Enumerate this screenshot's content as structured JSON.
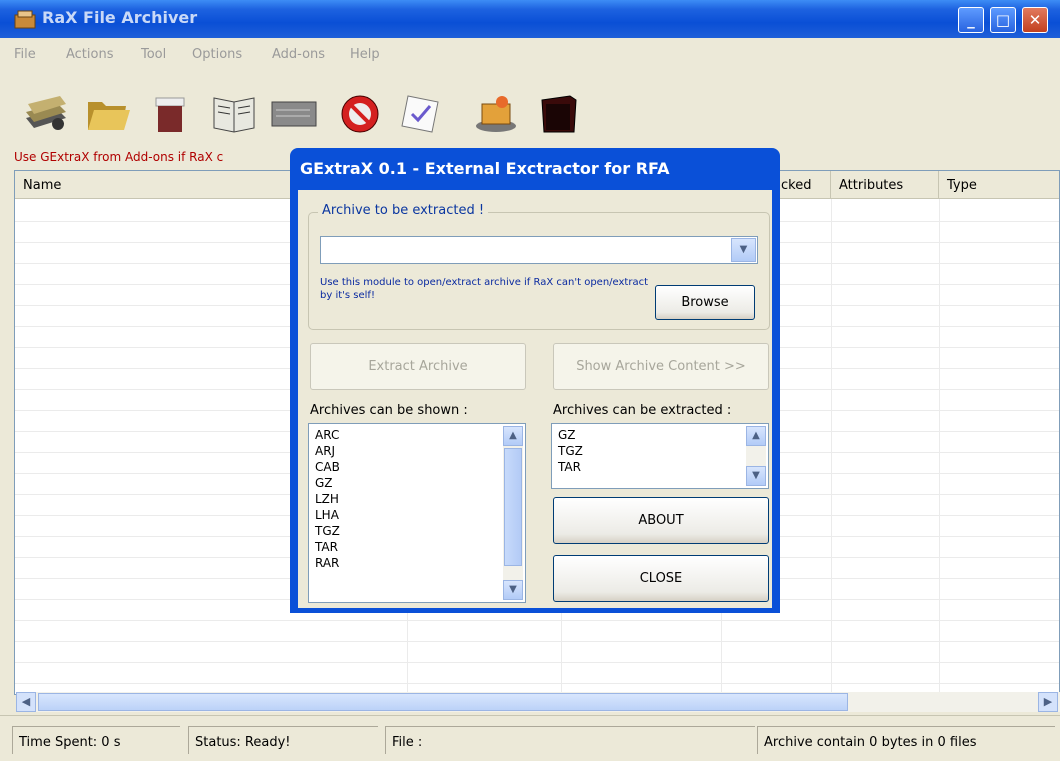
{
  "window": {
    "title": "RaX File Archiver",
    "controls": {
      "minimize": "_",
      "maximize": "□",
      "close": "✕"
    }
  },
  "menu": [
    "File",
    "Actions",
    "Tool",
    "Options",
    "Add-ons",
    "Help"
  ],
  "toolbar": {
    "icons": [
      "archive-stack-icon",
      "open-folder-icon",
      "shredder-bin-icon",
      "book-icon",
      "drive-icon",
      "no-entry-icon",
      "checklist-icon",
      "package-icon",
      "dark-box-icon"
    ]
  },
  "hint": "Use GExtraX from Add-ons if RaX c",
  "list": {
    "columns": [
      "Name",
      "cked",
      "Attributes",
      "Type"
    ]
  },
  "status": {
    "time": "Time Spent: 0 s",
    "state": "Status: Ready!",
    "file": "File :",
    "summary": "Archive contain 0 bytes in 0 files"
  },
  "dialog": {
    "title": "GExtraX 0.1 - External Exctractor for RFA",
    "group_label": "Archive to be extracted !",
    "combo_value": "",
    "info": "Use this module to open/extract archive  if RaX can't open/extract by it's self!",
    "browse": "Browse",
    "extract": "Extract Archive",
    "show": "Show Archive Content >>",
    "shown_label": "Archives can be shown :",
    "extract_label": "Archives can be extracted :",
    "shown_list": [
      "ARC",
      "ARJ",
      "CAB",
      "GZ",
      "LZH",
      "LHA",
      "TGZ",
      "TAR",
      "RAR"
    ],
    "extract_list": [
      "GZ",
      "TGZ",
      "TAR"
    ],
    "about": "ABOUT",
    "close": "CLOSE"
  },
  "colors": {
    "title_blue": "#0a50d8",
    "hint_red": "#b00000",
    "info_blue": "#0a2aa0"
  }
}
